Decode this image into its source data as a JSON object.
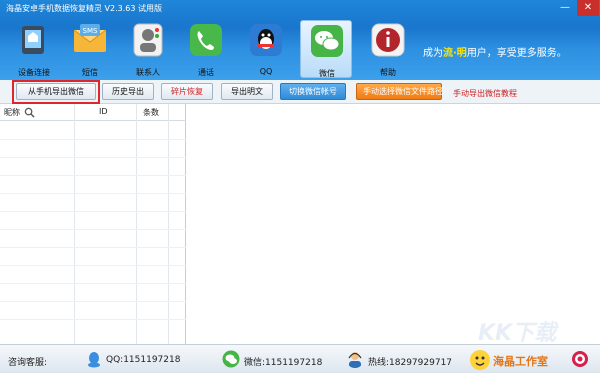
{
  "window": {
    "title": "海晶安卓手机数据恢复精灵 V2.3.63 试用版",
    "minimize": "—",
    "close": "✕"
  },
  "toolbar": {
    "items": [
      {
        "label": "设备连接",
        "icon": "device-connect-icon"
      },
      {
        "label": "短信",
        "icon": "sms-icon"
      },
      {
        "label": "联系人",
        "icon": "contacts-icon"
      },
      {
        "label": "通话",
        "icon": "call-icon"
      },
      {
        "label": "QQ",
        "icon": "qq-icon"
      },
      {
        "label": "微信",
        "icon": "wechat-icon"
      },
      {
        "label": "帮助",
        "icon": "help-icon"
      }
    ],
    "promo_prefix": "成为",
    "promo_highlight": "流·明",
    "promo_suffix": "用户，享受更多服务。"
  },
  "actions": {
    "export_from_phone": "从手机导出微信",
    "history_export": "历史导出",
    "fragment_restore": "碎片恢复",
    "export_plaintext": "导出明文",
    "switch_account": "切换微信帐号",
    "manual_select_path": "手动选择微信文件路径",
    "manual_tutorial": "手动导出微信教程"
  },
  "grid": {
    "columns": [
      "昵称",
      "ID",
      "条数"
    ]
  },
  "statusbar": {
    "consult": "咨询客服:",
    "qq": "QQ:1151197218",
    "wechat": "微信:1151197218",
    "hotline": "热线:18297929717",
    "brand": "海晶工作室"
  },
  "watermark": "KK下载",
  "colors": {
    "titlebar": "#1976cc",
    "accent_red": "#d02020",
    "switch_btn": "#2f8bd8",
    "manual_btn": "#f07b14",
    "brand": "#e4761a"
  }
}
